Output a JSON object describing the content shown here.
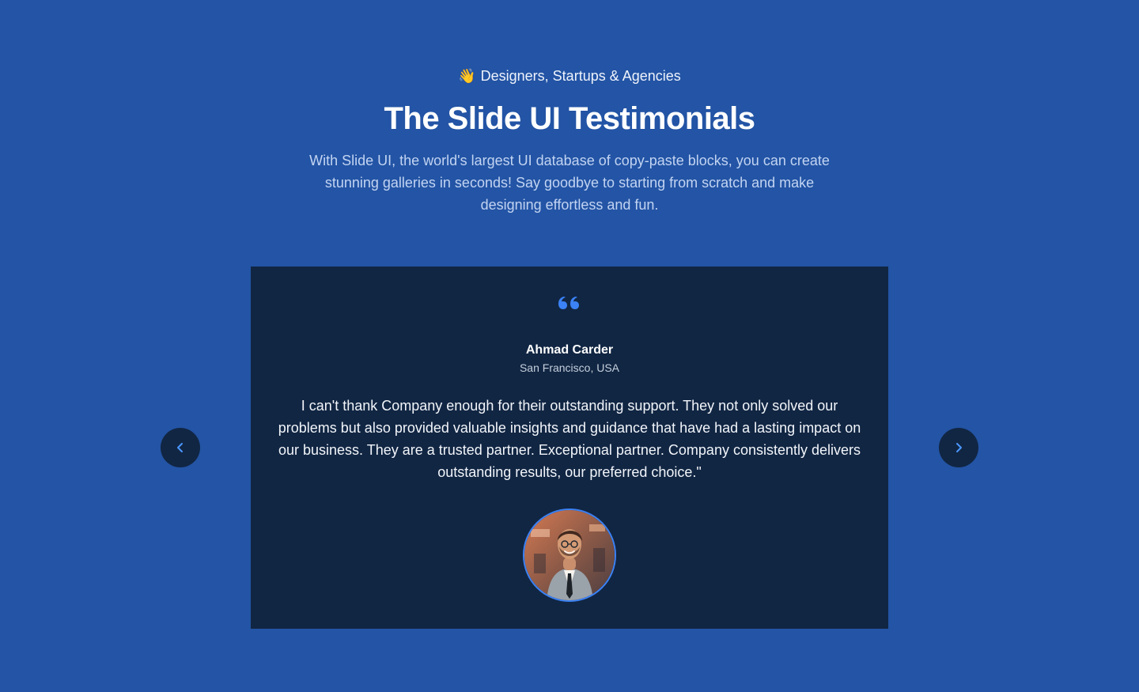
{
  "header": {
    "eyebrow_icon": "waving-hand-icon",
    "eyebrow_emoji": "👋",
    "eyebrow": "Designers, Startups & Agencies",
    "title": "The Slide UI Testimonials",
    "subtitle": "With Slide UI, the world's largest UI database of copy-paste blocks, you can create stunning galleries in seconds! Say goodbye to starting from scratch and make designing effortless and fun."
  },
  "testimonial": {
    "quote_icon": "quote-icon",
    "name": "Ahmad Carder",
    "location": "San Francisco, USA",
    "text": "I can't thank Company enough for their outstanding support. They not only solved our problems but also provided valuable insights and guidance that have had a lasting impact on our business. They are a trusted partner. Exceptional partner. Company consistently delivers outstanding results, our preferred choice.\"",
    "avatar_alt": "Ahmad Carder"
  },
  "controls": {
    "prev_icon": "chevron-left-icon",
    "next_icon": "chevron-right-icon"
  },
  "colors": {
    "background": "#2354a5",
    "card": "#112643",
    "accent": "#3b82f6",
    "subtitle": "#c2d4f2"
  }
}
